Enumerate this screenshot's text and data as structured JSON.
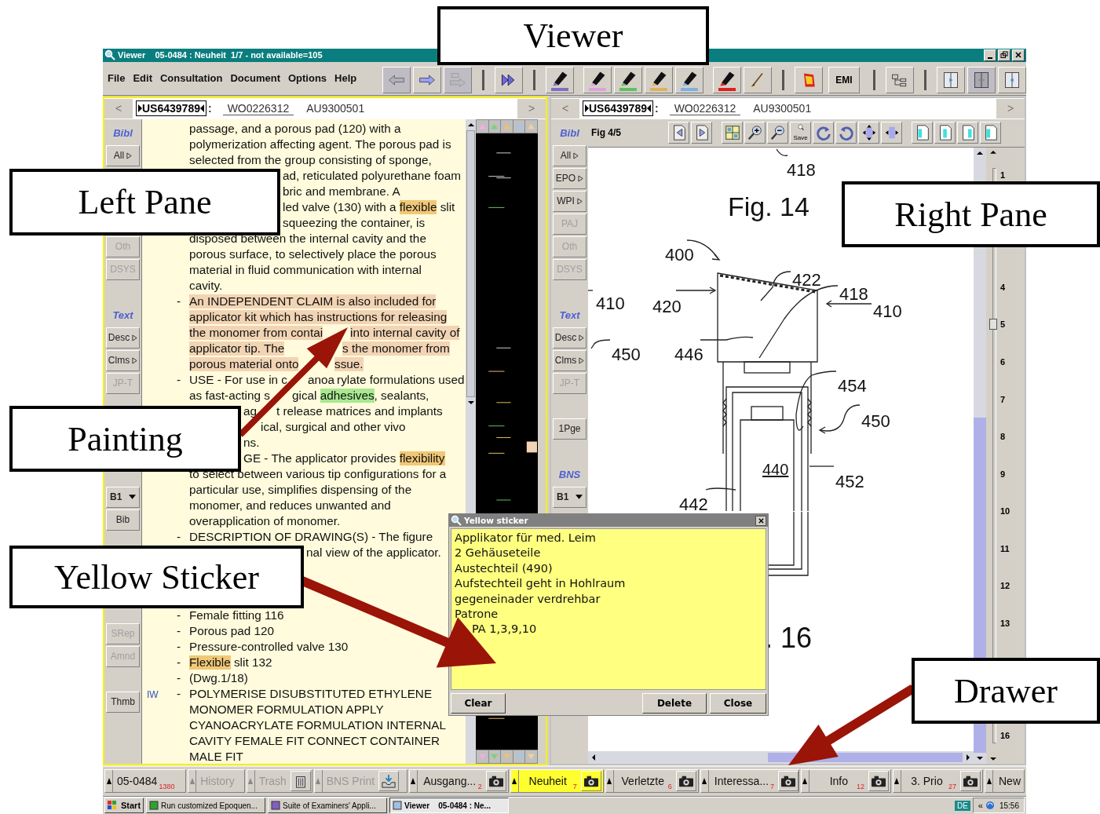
{
  "window": {
    "title": "Viewer    05-0484 : Neuheit  1/7 - not available=105"
  },
  "menu": [
    {
      "label": "File"
    },
    {
      "label": "Edit"
    },
    {
      "label": "Consultation"
    },
    {
      "label": "Document"
    },
    {
      "label": "Options"
    },
    {
      "label": "Help"
    }
  ],
  "toolbar": [
    {
      "kind": "back",
      "disabled": true
    },
    {
      "kind": "forward",
      "disabled": false
    },
    {
      "kind": "copy",
      "disabled": true
    },
    {
      "kind": "sep"
    },
    {
      "kind": "fast",
      "disabled": false
    },
    {
      "kind": "sep"
    },
    {
      "kind": "marker",
      "color": "#8070c0",
      "disabled": false
    },
    {
      "kind": "gap"
    },
    {
      "kind": "marker",
      "color": "#e0a0e0",
      "disabled": false
    },
    {
      "kind": "marker",
      "color": "#60c060",
      "disabled": false
    },
    {
      "kind": "marker",
      "color": "#e0b060",
      "disabled": false
    },
    {
      "kind": "marker",
      "color": "#80b0e0",
      "disabled": false
    },
    {
      "kind": "gap"
    },
    {
      "kind": "marker",
      "color": "#e02020",
      "disabled": false
    },
    {
      "kind": "brush",
      "disabled": false
    },
    {
      "kind": "sep"
    },
    {
      "kind": "book",
      "disabled": false
    },
    {
      "kind": "text",
      "label": "EMI",
      "disabled": false
    },
    {
      "kind": "sep"
    },
    {
      "kind": "tree",
      "disabled": false
    },
    {
      "kind": "sep"
    },
    {
      "kind": "split-left",
      "disabled": false
    },
    {
      "kind": "split-both",
      "disabled": true
    },
    {
      "kind": "split-right",
      "disabled": false
    }
  ],
  "left_pane": {
    "active": true,
    "docbar": {
      "prev": "<",
      "next": ">",
      "separator": ":",
      "docs": [
        {
          "label": "US6439789",
          "selected": true,
          "underlined": false
        },
        {
          "label": "WO0226312",
          "selected": false,
          "underlined": true
        },
        {
          "label": "AU9300501",
          "selected": false,
          "underlined": false
        }
      ]
    },
    "sidebar": [
      {
        "kind": "header",
        "label": "Bibl"
      },
      {
        "kind": "expand",
        "label": "All",
        "disabled": false
      },
      {
        "kind": "space"
      },
      {
        "kind": "space"
      },
      {
        "kind": "space"
      },
      {
        "kind": "button",
        "label": "Oth",
        "disabled": true
      },
      {
        "kind": "button",
        "label": "DSYS",
        "disabled": true
      },
      {
        "kind": "space"
      },
      {
        "kind": "header",
        "label": "Text"
      },
      {
        "kind": "expand",
        "label": "Desc",
        "disabled": false
      },
      {
        "kind": "expand",
        "label": "Clms",
        "disabled": false
      },
      {
        "kind": "button",
        "label": "JP-T",
        "disabled": true
      },
      {
        "kind": "space"
      },
      {
        "kind": "space"
      },
      {
        "kind": "space"
      },
      {
        "kind": "space"
      },
      {
        "kind": "dropdown",
        "label": "B1"
      },
      {
        "kind": "button",
        "label": "Bib",
        "disabled": false
      },
      {
        "kind": "space"
      },
      {
        "kind": "space"
      },
      {
        "kind": "space"
      },
      {
        "kind": "space"
      },
      {
        "kind": "button",
        "label": "SRep",
        "disabled": true
      },
      {
        "kind": "button",
        "label": "Amnd",
        "disabled": true
      },
      {
        "kind": "space"
      },
      {
        "kind": "button",
        "label": "Thmb",
        "disabled": false
      }
    ],
    "lines": [
      {
        "kind": "text",
        "segments": [
          {
            "text": "passage, and a porous pad (120) with a"
          }
        ]
      },
      {
        "kind": "text",
        "segments": [
          {
            "text": "polymerization affecting agent. The porous pad is"
          }
        ]
      },
      {
        "kind": "text",
        "segments": [
          {
            "text": "selected from the group consisting of sponge,"
          }
        ]
      },
      {
        "kind": "text",
        "segments": [
          {
            "text": "ad, reticulated polyurethane foam"
          }
        ]
      },
      {
        "kind": "text",
        "segments": [
          {
            "text": "bric and membrane. A"
          }
        ]
      },
      {
        "kind": "text",
        "segments": [
          {
            "text": "led valve (130) with a "
          },
          {
            "text": "flexible",
            "color": "#f0c878"
          },
          {
            "text": " slit"
          }
        ]
      },
      {
        "kind": "text",
        "segments": [
          {
            "text": "squeezing the container, is"
          }
        ]
      },
      {
        "kind": "text",
        "segments": [
          {
            "text": "disposed between the internal cavity and the"
          }
        ]
      },
      {
        "kind": "text",
        "segments": [
          {
            "text": "porous surface, to selectively place the porous"
          }
        ]
      },
      {
        "kind": "text",
        "segments": [
          {
            "text": "material in fluid communication with internal"
          }
        ]
      },
      {
        "kind": "text",
        "segments": [
          {
            "text": "cavity."
          }
        ]
      },
      {
        "kind": "text",
        "bullet": "-",
        "segments": [
          {
            "text": "An INDEPENDENT CLAIM is also included for",
            "color": "#f2d4b4"
          }
        ]
      },
      {
        "kind": "text",
        "segments": [
          {
            "text": "applicator kit which has instructions for releasing",
            "color": "#f2d4b4"
          }
        ]
      },
      {
        "kind": "text",
        "segments": [
          {
            "text": "the monomer from contai",
            "color": "#f2d4b4"
          },
          {
            "text": "into internal cavity of",
            "color": "#f2d4b4"
          }
        ]
      },
      {
        "kind": "text",
        "segments": [
          {
            "text": "applicator tip. The",
            "color": "#f2d4b4"
          },
          {
            "text": "s the monomer from",
            "color": "#f2d4b4"
          }
        ]
      },
      {
        "kind": "text",
        "segments": [
          {
            "text": "porous material onto",
            "color": "#f2d4b4"
          },
          {
            "text": "ssue.",
            "color": "#f2d4b4"
          }
        ]
      },
      {
        "kind": "text",
        "bullet": "-",
        "segments": [
          {
            "text": "USE - For use in c"
          },
          {
            "text": "anoa"
          },
          {
            "text": "rylate formulations used"
          }
        ]
      },
      {
        "kind": "text",
        "segments": [
          {
            "text": "as fast-acting s"
          },
          {
            "text": "gical "
          },
          {
            "text": "adhesives",
            "color": "#a8e890"
          },
          {
            "text": ", sealants,"
          }
        ]
      },
      {
        "kind": "text",
        "segments": [
          {
            "text": "ag"
          },
          {
            "text": "t release matrices and implants"
          }
        ]
      },
      {
        "kind": "text",
        "segments": [
          {
            "text": "ical, surgical and other vivo"
          }
        ]
      },
      {
        "kind": "text",
        "segments": [
          {
            "text": "ns."
          }
        ]
      },
      {
        "kind": "text",
        "segments": [
          {
            "text": "GE - The applicator provides "
          },
          {
            "text": "flexibility",
            "color": "#f0c878"
          }
        ]
      },
      {
        "kind": "text",
        "segments": [
          {
            "text": "to select between various tip configurations for a"
          }
        ]
      },
      {
        "kind": "text",
        "segments": [
          {
            "text": "particular use, simplifies dispensing of the"
          }
        ]
      },
      {
        "kind": "text",
        "segments": [
          {
            "text": "monomer, and reduces unwanted and"
          }
        ]
      },
      {
        "kind": "text",
        "segments": [
          {
            "text": "overapplication of monomer."
          }
        ]
      },
      {
        "kind": "text",
        "bullet": "-",
        "segments": [
          {
            "text": "DESCRIPTION OF DRAWING(S) - The figure"
          }
        ]
      },
      {
        "kind": "text",
        "segments": [
          {
            "text": "nal view of the applicator."
          }
        ]
      },
      {
        "kind": "blank"
      },
      {
        "kind": "blank"
      },
      {
        "kind": "blank"
      },
      {
        "kind": "text",
        "bullet": "-",
        "segments": [
          {
            "text": "Female fitting 116"
          }
        ]
      },
      {
        "kind": "text",
        "bullet": "-",
        "segments": [
          {
            "text": "Porous pad 120"
          }
        ]
      },
      {
        "kind": "text",
        "bullet": "-",
        "segments": [
          {
            "text": "Pressure-controlled valve 130"
          }
        ]
      },
      {
        "kind": "text",
        "bullet": "-",
        "segments": [
          {
            "text": "Flexible",
            "color": "#f0c878"
          },
          {
            "text": " slit 132"
          }
        ]
      },
      {
        "kind": "text",
        "bullet": "-",
        "segments": [
          {
            "text": "(Dwg.1/18)"
          }
        ]
      },
      {
        "kind": "text",
        "marker": "IW",
        "bullet": "-",
        "segments": [
          {
            "text": "POLYMERISE DISUBSTITUTED ETHYLENE"
          }
        ]
      },
      {
        "kind": "text",
        "segments": [
          {
            "text": "MONOMER FORMULATION APPLY"
          }
        ]
      },
      {
        "kind": "text",
        "segments": [
          {
            "text": "CYANOACRYLATE FORMULATION INTERNAL"
          }
        ]
      },
      {
        "kind": "text",
        "segments": [
          {
            "text": "CAVITY FEMALE FIT CONNECT CONTAINER"
          }
        ]
      },
      {
        "kind": "text",
        "segments": [
          {
            "text": "MALE FIT"
          }
        ]
      }
    ],
    "highlight_colors": [
      {
        "color": "#f0b0e0"
      },
      {
        "color": "#80d080"
      },
      {
        "color": "#f0c070"
      },
      {
        "color": "#a0c8f0"
      },
      {
        "color": "#f0d0a0"
      }
    ]
  },
  "right_pane": {
    "active": false,
    "docbar": {
      "prev": "<",
      "next": ">",
      "separator": ":",
      "docs": [
        {
          "label": "US6439789",
          "selected": true,
          "underlined": false
        },
        {
          "label": "WO0226312",
          "selected": false,
          "underlined": true
        },
        {
          "label": "AU9300501",
          "selected": false,
          "underlined": false
        }
      ]
    },
    "sidebar": [
      {
        "kind": "header",
        "label": "Bibl"
      },
      {
        "kind": "expand",
        "label": "All",
        "disabled": false
      },
      {
        "kind": "expand",
        "label": "EPO",
        "disabled": false
      },
      {
        "kind": "expand",
        "label": "WPI",
        "disabled": false
      },
      {
        "kind": "button",
        "label": "PAJ",
        "disabled": true
      },
      {
        "kind": "button",
        "label": "Oth",
        "disabled": true
      },
      {
        "kind": "button",
        "label": "DSYS",
        "disabled": true
      },
      {
        "kind": "space"
      },
      {
        "kind": "header",
        "label": "Text"
      },
      {
        "kind": "expand",
        "label": "Desc",
        "disabled": false
      },
      {
        "kind": "expand",
        "label": "Clms",
        "disabled": false
      },
      {
        "kind": "button",
        "label": "JP-T",
        "disabled": true
      },
      {
        "kind": "space"
      },
      {
        "kind": "button",
        "label": "1Pge",
        "disabled": false
      },
      {
        "kind": "space"
      },
      {
        "kind": "header",
        "label": "BNS"
      },
      {
        "kind": "dropdown",
        "label": "B1"
      }
    ],
    "figure_toolbar": {
      "title": "Fig 4/5",
      "tools": [
        {
          "kind": "prev-page"
        },
        {
          "kind": "next-page"
        },
        {
          "kind": "gap"
        },
        {
          "kind": "grid"
        },
        {
          "kind": "zoom-in"
        },
        {
          "kind": "zoom-out"
        },
        {
          "kind": "save",
          "label": "Save"
        },
        {
          "kind": "rotate-cw"
        },
        {
          "kind": "rotate-ccw"
        },
        {
          "kind": "fit-height"
        },
        {
          "kind": "fit-width"
        },
        {
          "kind": "gap"
        },
        {
          "kind": "layout"
        },
        {
          "kind": "layout"
        },
        {
          "kind": "layout"
        },
        {
          "kind": "layout"
        }
      ]
    },
    "figure": {
      "labels": [
        {
          "kind": "number",
          "text": "418"
        },
        {
          "kind": "title",
          "text": "Fig. 14"
        },
        {
          "kind": "number",
          "text": "400"
        },
        {
          "kind": "number",
          "text": "422"
        },
        {
          "kind": "number",
          "text": "418"
        },
        {
          "kind": "number",
          "text": "410"
        },
        {
          "kind": "number",
          "text": "410"
        },
        {
          "kind": "number",
          "text": "420"
        },
        {
          "kind": "number",
          "text": "450"
        },
        {
          "kind": "number",
          "text": "446"
        },
        {
          "kind": "number",
          "text": "454"
        },
        {
          "kind": "number",
          "text": "450"
        },
        {
          "kind": "underlined",
          "text": "440"
        },
        {
          "kind": "number",
          "text": "452"
        },
        {
          "kind": "number",
          "text": "442"
        },
        {
          "kind": "title",
          "text": ". 16"
        }
      ]
    },
    "ruler": [
      {
        "kind": "tick",
        "label": "1",
        "selected": false
      },
      {
        "kind": "blank"
      },
      {
        "kind": "blank"
      },
      {
        "kind": "tick",
        "label": "4",
        "selected": false
      },
      {
        "kind": "tick",
        "label": "5",
        "selected": true
      },
      {
        "kind": "tick",
        "label": "6",
        "selected": false
      },
      {
        "kind": "tick",
        "label": "7",
        "selected": false
      },
      {
        "kind": "tick",
        "label": "8",
        "selected": false
      },
      {
        "kind": "tick",
        "label": "9",
        "selected": false
      },
      {
        "kind": "tick",
        "label": "10",
        "selected": false
      },
      {
        "kind": "tick",
        "label": "11",
        "selected": false
      },
      {
        "kind": "tick",
        "label": "12",
        "selected": false
      },
      {
        "kind": "tick",
        "label": "13",
        "selected": false
      },
      {
        "kind": "blank"
      },
      {
        "kind": "blank"
      },
      {
        "kind": "tick",
        "label": "16",
        "selected": false
      }
    ]
  },
  "sticker": {
    "title": "Yellow sticker",
    "lines": [
      "Applikator für med. Leim",
      "2 Gehäuseteile",
      "Austechteil (490)",
      "Aufstechteil geht in Hohlraum",
      "gegeneinader verdrehbar",
      "Patrone",
      "PA 1,3,9,10"
    ],
    "buttons": [
      {
        "label": "Clear",
        "kind": "left"
      },
      {
        "label": "Delete",
        "kind": "right"
      },
      {
        "label": "Close",
        "kind": "right"
      }
    ]
  },
  "drawer": [
    {
      "label": "05-0484",
      "count": "1380",
      "kind": "plain",
      "selected": false,
      "disabled": false
    },
    {
      "label": "History",
      "kind": "plain",
      "selected": false,
      "disabled": true
    },
    {
      "label": "Trash",
      "kind": "trash",
      "selected": false,
      "disabled": true
    },
    {
      "label": "BNS Print",
      "kind": "tray",
      "selected": false,
      "disabled": true
    },
    {
      "label": "Ausgang...",
      "count": "2",
      "kind": "camera",
      "selected": false,
      "disabled": false
    },
    {
      "label": "Neuheit",
      "count": "7",
      "kind": "camera",
      "selected": true,
      "disabled": false
    },
    {
      "label": "Verletzte",
      "count": "6",
      "kind": "camera",
      "selected": false,
      "disabled": false
    },
    {
      "label": "Interessa...",
      "count": "7",
      "kind": "camera",
      "selected": false,
      "disabled": false
    },
    {
      "label": "Info",
      "count": "12",
      "kind": "camera",
      "selected": false,
      "disabled": false
    },
    {
      "label": "3. Prio",
      "count": "27",
      "kind": "camera",
      "selected": false,
      "disabled": false
    },
    {
      "label": "New",
      "kind": "end",
      "selected": false,
      "disabled": false
    }
  ],
  "taskbar": {
    "start": "Start",
    "tasks": [
      {
        "label": "Run customized Epoquen...",
        "selected": false
      },
      {
        "label": "Suite of Examiners' Appli...",
        "selected": false
      },
      {
        "label": "Viewer    05-0484 : Ne...",
        "selected": true
      }
    ],
    "language": "DE",
    "expand": "«",
    "clock": "15:56"
  },
  "callouts": [
    {
      "text": "Viewer"
    },
    {
      "text": "Left Pane"
    },
    {
      "text": "Right Pane"
    },
    {
      "text": "Painting"
    },
    {
      "text": "Yellow Sticker"
    },
    {
      "text": "Drawer"
    }
  ]
}
